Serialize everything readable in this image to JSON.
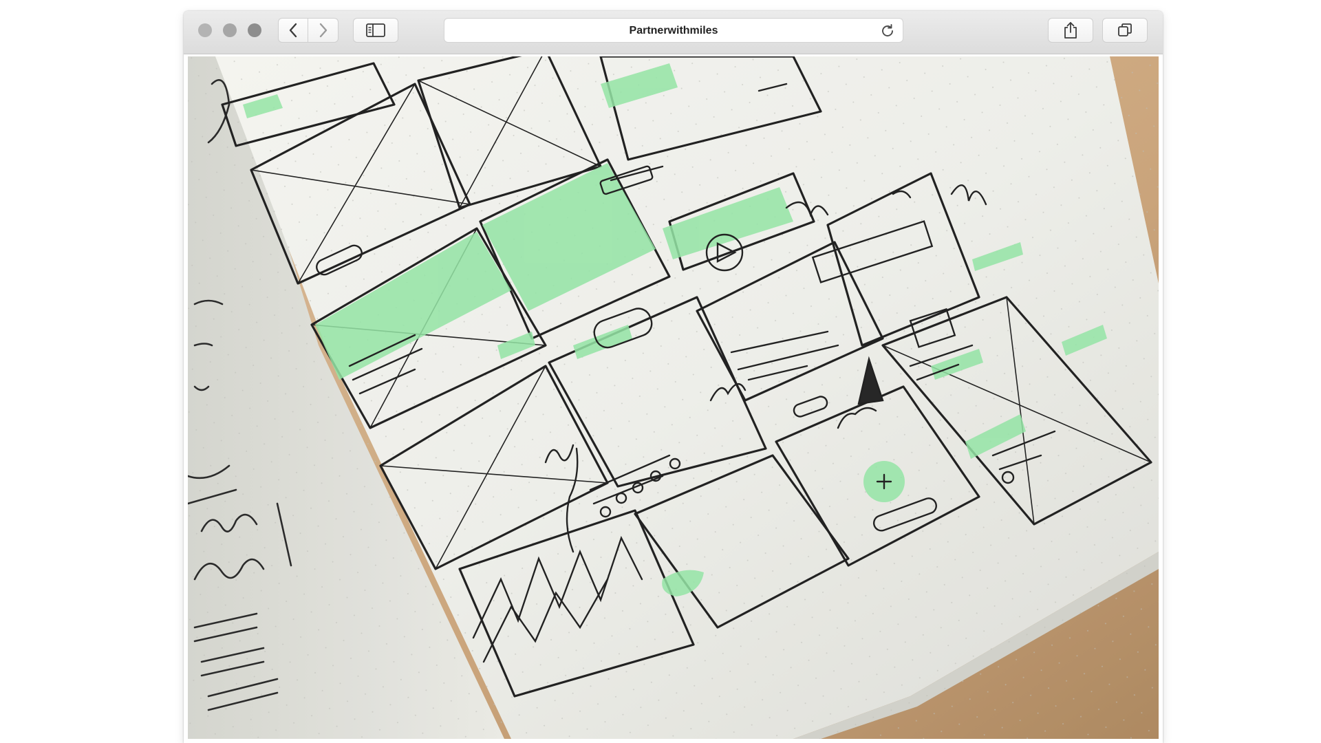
{
  "window": {
    "address_text": "Partnerwithmiles"
  },
  "icons": {
    "back": "chevron-left-icon",
    "forward": "chevron-right-icon",
    "sidebar": "sidebar-icon",
    "reload": "reload-icon",
    "share": "share-icon",
    "tabs": "tabs-icon"
  },
  "colors": {
    "paper": "#eeefea",
    "ink": "#1c1c1c",
    "highlight": "#8ee3a0",
    "desk": "#c8a47c"
  }
}
